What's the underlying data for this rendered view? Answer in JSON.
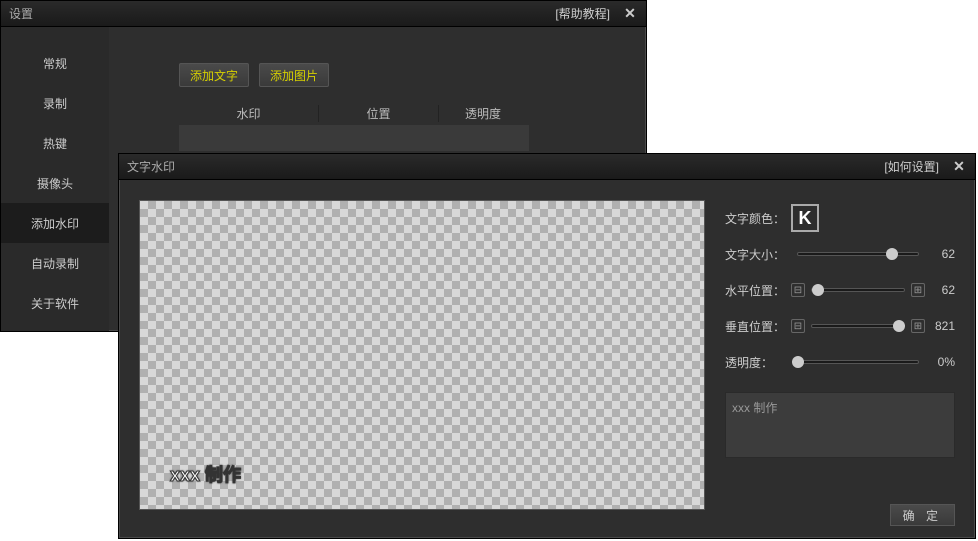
{
  "settings": {
    "title": "设置",
    "help": "[帮助教程]",
    "sidebar": [
      "常规",
      "录制",
      "热键",
      "摄像头",
      "添加水印",
      "自动录制",
      "关于软件"
    ],
    "activeIndex": 4,
    "buttons": {
      "addText": "添加文字",
      "addImage": "添加图片"
    },
    "columns": {
      "watermark": "水印",
      "position": "位置",
      "opacity": "透明度"
    }
  },
  "dialog": {
    "title": "文字水印",
    "help": "[如何设置]",
    "watermarkText": "xxx 制作",
    "labels": {
      "color": "文字颜色：",
      "size": "文字大小：",
      "hpos": "水平位置：",
      "vpos": "垂直位置：",
      "opacity": "透明度："
    },
    "colorSample": "K",
    "values": {
      "size": "62",
      "hpos": "62",
      "vpos": "821",
      "opacity": "0%"
    },
    "sliderPct": {
      "size": 78,
      "hpos": 7,
      "vpos": 95,
      "opacity": 0
    },
    "inputText": "xxx 制作",
    "confirm": "确 定"
  }
}
